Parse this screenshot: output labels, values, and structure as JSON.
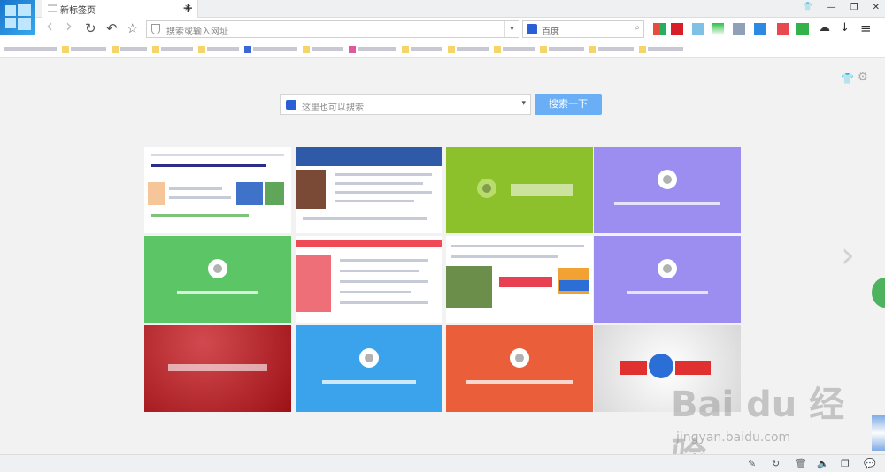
{
  "tab": {
    "title": "新标签页",
    "close": "×",
    "new_tab": "+"
  },
  "window_controls": {
    "skin": "👕",
    "minimize": "—",
    "restore": "❐",
    "close": "✕"
  },
  "toolbar": {
    "back": "‹",
    "forward": "›",
    "reload": "↻",
    "undo": "↶",
    "favorite": "☆",
    "url_placeholder": "搜索或输入网址",
    "search_engine": "百度",
    "download": "↓",
    "menu": "≡",
    "cloud": "☁"
  },
  "main_search": {
    "placeholder": "这里也可以搜索",
    "button": "搜索一下"
  },
  "tiles": [
    {
      "kind": "screenshot",
      "color": "#ffffff"
    },
    {
      "kind": "screenshot",
      "color": "#2f5aa8"
    },
    {
      "kind": "brand",
      "color": "#8dc12b",
      "label": ""
    },
    {
      "kind": "brand",
      "color": "#9b8ef0",
      "label": ""
    },
    {
      "kind": "brand",
      "color": "#5cc667",
      "label": ""
    },
    {
      "kind": "screenshot",
      "color": "#ee4b56"
    },
    {
      "kind": "screenshot",
      "color": "#ffffff"
    },
    {
      "kind": "brand",
      "color": "#9b8ef0",
      "label": ""
    },
    {
      "kind": "brand",
      "color": "#b31a1f",
      "label": ""
    },
    {
      "kind": "brand",
      "color": "#3aa3ec",
      "label": ""
    },
    {
      "kind": "brand",
      "color": "#ea5f39",
      "label": ""
    },
    {
      "kind": "brand",
      "color": "#e8e8e8",
      "label": ""
    }
  ],
  "watermark": {
    "brand": "Bai du 经验",
    "url": "jingyan.baidu.com"
  },
  "statusbar_icons": [
    "pin-icon",
    "refresh-icon",
    "trash-icon",
    "volume-icon",
    "window-icon",
    "chat-icon"
  ]
}
